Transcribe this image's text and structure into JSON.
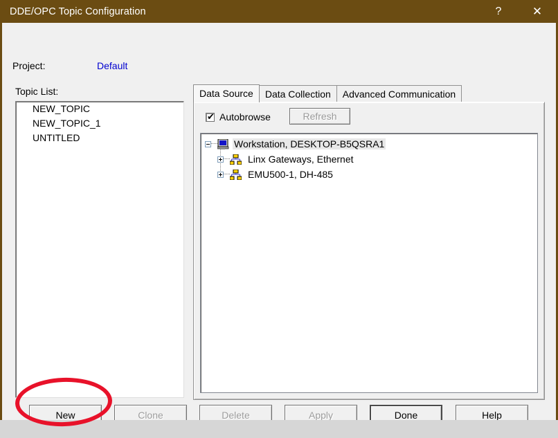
{
  "window": {
    "title": "DDE/OPC Topic Configuration",
    "titlebar_color": "#6b4c12",
    "help_glyph": "?",
    "close_glyph": "✕"
  },
  "project": {
    "label": "Project:",
    "value": "Default",
    "value_color": "#0000cf"
  },
  "topic_list": {
    "label": "Topic List:",
    "items": [
      "NEW_TOPIC",
      "NEW_TOPIC_1",
      "UNTITLED"
    ]
  },
  "tabs": [
    {
      "label": "Data Source",
      "active": true
    },
    {
      "label": "Data Collection",
      "active": false
    },
    {
      "label": "Advanced Communication",
      "active": false
    }
  ],
  "data_source": {
    "autobrowse": {
      "label": "Autobrowse",
      "checked": true,
      "tick_glyph": "✔"
    },
    "refresh_button": {
      "label": "Refresh",
      "enabled": false
    },
    "tree": [
      {
        "label": "Workstation, DESKTOP-B5QSRA1",
        "icon": "monitor-icon",
        "expander": "minus",
        "selected": true,
        "level": 0
      },
      {
        "label": "Linx Gateways, Ethernet",
        "icon": "network-icon",
        "expander": "plus",
        "selected": false,
        "level": 1
      },
      {
        "label": "EMU500-1, DH-485",
        "icon": "network-icon",
        "expander": "plus",
        "selected": false,
        "level": 1
      }
    ]
  },
  "buttons": {
    "new": {
      "label": "New",
      "enabled": true
    },
    "clone": {
      "label": "Clone",
      "enabled": false
    },
    "delete": {
      "label": "Delete",
      "enabled": false
    },
    "apply": {
      "label": "Apply",
      "enabled": false
    },
    "done": {
      "label": "Done",
      "enabled": true,
      "default": true
    },
    "help": {
      "label": "Help",
      "enabled": true
    }
  },
  "annotation": {
    "shape": "ellipse",
    "color": "#e8122a",
    "target": "New"
  }
}
